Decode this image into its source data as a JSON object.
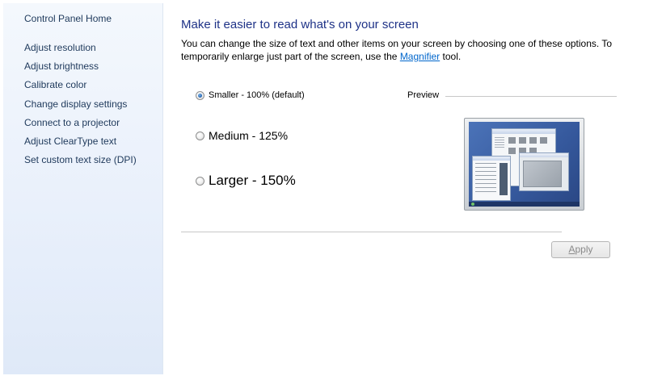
{
  "sidebar": {
    "home_link": "Control Panel Home",
    "items": [
      {
        "label": "Adjust resolution"
      },
      {
        "label": "Adjust brightness"
      },
      {
        "label": "Calibrate color"
      },
      {
        "label": "Change display settings"
      },
      {
        "label": "Connect to a projector"
      },
      {
        "label": "Adjust ClearType text"
      },
      {
        "label": "Set custom text size (DPI)"
      }
    ]
  },
  "main": {
    "title": "Make it easier to read what's on your screen",
    "description_before": "You can change the size of text and other items on your screen by choosing one of these options. To temporarily enlarge just part of the screen, use the ",
    "magnifier_link": "Magnifier",
    "description_after": " tool.",
    "options": [
      {
        "label": "Smaller - 100% (default)",
        "selected": true
      },
      {
        "label": "Medium - 125%",
        "selected": false
      },
      {
        "label": "Larger - 150%",
        "selected": false
      }
    ],
    "preview_label": "Preview",
    "apply_button": {
      "prefix": "",
      "accel": "A",
      "rest": "pply",
      "enabled": false
    }
  }
}
